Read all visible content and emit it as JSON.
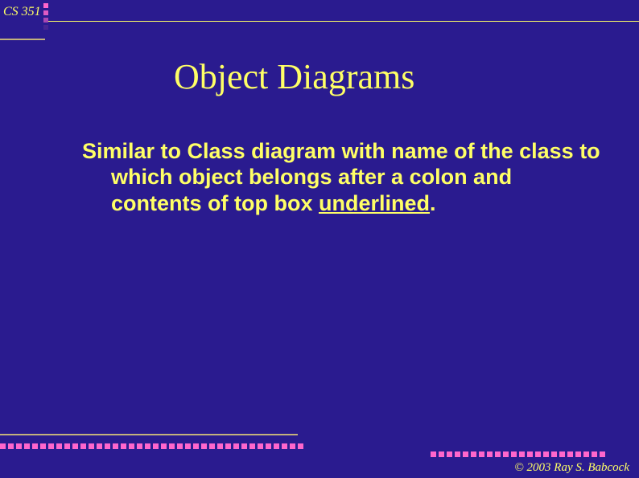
{
  "course_code": "CS 351",
  "title": "Object Diagrams",
  "body": {
    "prefix": "Similar to Class diagram with name of the class to which object belongs after a colon and contents of top box ",
    "underlined": "underlined",
    "suffix": "."
  },
  "copyright": "© 2003  Ray S. Babcock"
}
